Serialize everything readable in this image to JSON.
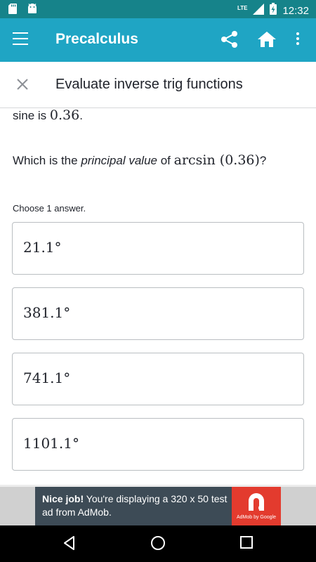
{
  "status_bar": {
    "time": "12:32",
    "network": "LTE",
    "icons": [
      "sd-card-icon",
      "android-icon",
      "signal-icon",
      "battery-charging-icon"
    ]
  },
  "app_bar": {
    "title": "Precalculus",
    "icons": [
      "menu-icon",
      "share-icon",
      "home-icon",
      "more-vert-icon"
    ]
  },
  "exercise": {
    "title": "Evaluate inverse trig functions",
    "previous_line": {
      "text": "sine is ",
      "math": "0.36",
      "end": "."
    },
    "question": {
      "prefix": "Which is the ",
      "emphasis": "principal value",
      "middle": " of ",
      "math": "arcsin (0.36)",
      "suffix": "?"
    },
    "instructions": "Choose 1 answer.",
    "choices": [
      "21.1°",
      "381.1°",
      "741.1°",
      "1101.1°"
    ]
  },
  "ad": {
    "bold": "Nice job!",
    "text": " You're displaying a 320 x 50 test ad from AdMob.",
    "brand": "AdMob by Google",
    "brand_color": "#e33b2e"
  },
  "colors": {
    "status_bar": "#16838a",
    "app_bar": "#1fa5c4",
    "text": "#21242c"
  }
}
